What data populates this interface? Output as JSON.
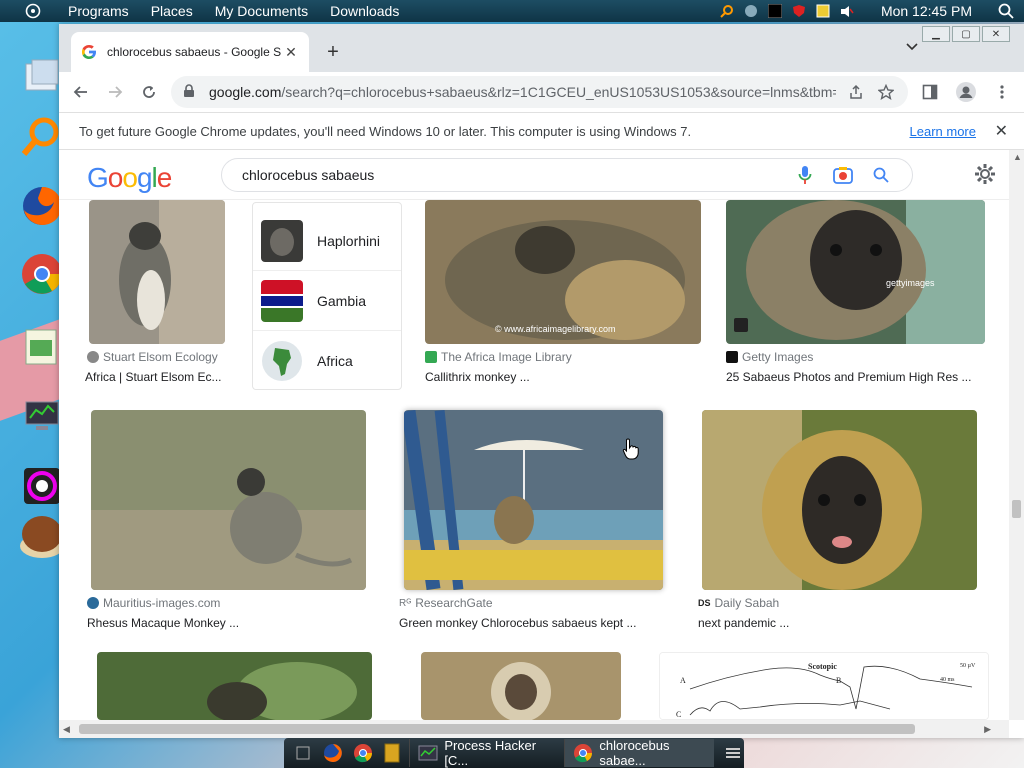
{
  "top_panel": {
    "menu_items": [
      "Programs",
      "Places",
      "My Documents",
      "Downloads"
    ],
    "clock": "Mon 12:45 PM"
  },
  "taskbar": {
    "buttons": [
      {
        "label": "Process Hacker [C..."
      },
      {
        "label": "chlorocebus sabae..."
      }
    ]
  },
  "browser": {
    "tab_title": "chlorocebus sabaeus - Google S",
    "url_host": "google.com",
    "url_path": "/search?q=chlorocebus+sabaeus&rlz=1C1GCEU_enUS1053US1053&source=lnms&tbm=is...",
    "infobar_text": "To get future Google Chrome updates, you'll need Windows 10 or later. This computer is using Windows 7.",
    "infobar_link": "Learn more"
  },
  "google": {
    "query": "chlorocebus sabaeus",
    "logo": [
      "G",
      "o",
      "o",
      "g",
      "l",
      "e"
    ],
    "logo_colors": [
      "#4285f4",
      "#ea4335",
      "#fbbc05",
      "#4285f4",
      "#34a853",
      "#ea4335"
    ]
  },
  "related": [
    {
      "label": "Haplorhini"
    },
    {
      "label": "Gambia"
    },
    {
      "label": "Africa"
    }
  ],
  "results": [
    {
      "source": "Stuart Elsom Ecology",
      "title": "Africa | Stuart Elsom Ec..."
    },
    {
      "source": "The Africa Image Library",
      "title": "Callithrix monkey ...",
      "watermark": "© www.africaimagelibrary.com"
    },
    {
      "source": "Getty Images",
      "title": "25 Sabaeus Photos and Premium High Res ...",
      "watermark": "gettyimages"
    },
    {
      "source": "Mauritius-images.com",
      "title": "Rhesus Macaque Monkey ..."
    },
    {
      "source": "ResearchGate",
      "title": "Green monkey Chlorocebus sabaeus kept ..."
    },
    {
      "source": "Daily Sabah",
      "title": "next pandemic ..."
    }
  ],
  "chart_thumb": {
    "title": "Scotopic",
    "labels": [
      "A",
      "B",
      "C"
    ],
    "scale_value": "50 µV",
    "scale_time": "40 ms"
  }
}
